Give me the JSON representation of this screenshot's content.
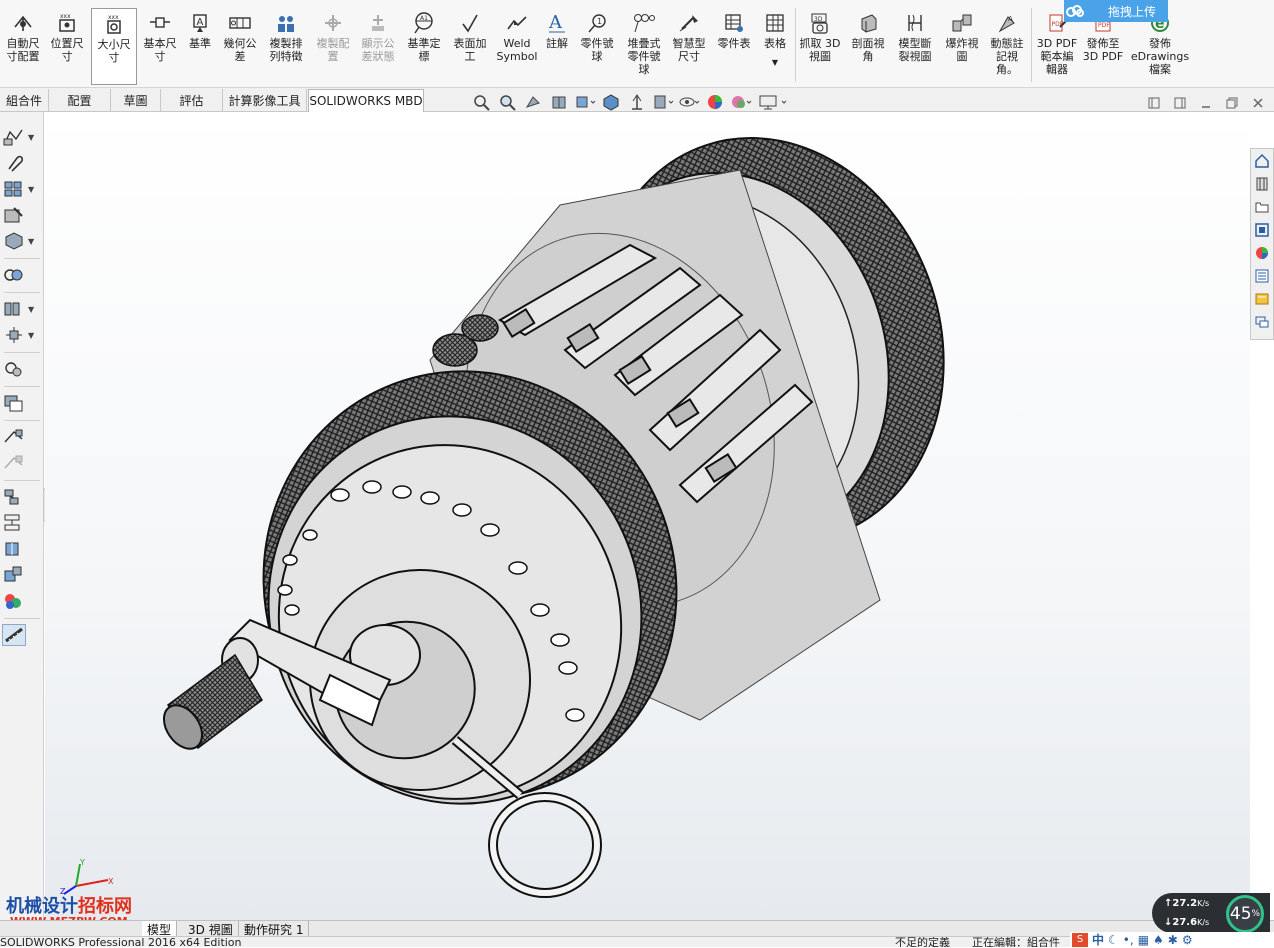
{
  "upload_widget": {
    "label": "拖拽上传"
  },
  "ribbon": {
    "buttons": [
      {
        "label": "自動尺\n寸配置",
        "icon": "auto-dimension-icon"
      },
      {
        "label": "位置尺\n寸",
        "icon": "location-dimension-icon"
      },
      {
        "label": "大小尺\n寸",
        "icon": "size-dimension-icon"
      },
      {
        "label": "基本尺\n寸",
        "icon": "basic-dimension-icon"
      },
      {
        "label": "基準",
        "icon": "datum-icon"
      },
      {
        "label": "幾何公\n差",
        "icon": "geometric-tolerance-icon"
      },
      {
        "label": "複製排\n列特徵",
        "icon": "copy-pattern-icon"
      },
      {
        "label": "複製配\n置",
        "icon": "copy-scheme-icon"
      },
      {
        "label": "顯示公\n差狀態",
        "icon": "tolerance-status-icon"
      },
      {
        "label": "基準定\n標",
        "icon": "datum-target-icon"
      },
      {
        "label": "表面加\n工",
        "icon": "surface-finish-icon"
      },
      {
        "label": "Weld\nSymbol",
        "icon": "weld-symbol-icon"
      },
      {
        "label": "註解",
        "icon": "note-icon"
      },
      {
        "label": "零件號\n球",
        "icon": "balloon-icon"
      },
      {
        "label": "堆疊式\n零件號\n球",
        "icon": "stacked-balloon-icon"
      },
      {
        "label": "智慧型\n尺寸",
        "icon": "smart-dimension-icon"
      },
      {
        "label": "零件表",
        "icon": "bom-icon"
      },
      {
        "label": "表格",
        "icon": "table-icon"
      },
      {
        "label": "抓取 3D\n視圖",
        "icon": "capture-3d-view-icon"
      },
      {
        "label": "剖面視\n角",
        "icon": "section-view-icon"
      },
      {
        "label": "模型斷\n裂視圖",
        "icon": "broken-view-icon"
      },
      {
        "label": "爆炸視\n圖",
        "icon": "exploded-view-icon"
      },
      {
        "label": "動態註\n記視\n角。",
        "icon": "dynamic-annotation-icon"
      },
      {
        "label": "3D PDF\n範本編\n輯器",
        "icon": "3d-pdf-template-icon"
      },
      {
        "label": "發佈至\n3D PDF",
        "icon": "publish-3d-pdf-icon"
      },
      {
        "label": "發佈\neDrawings\n檔案",
        "icon": "edrawings-icon"
      }
    ]
  },
  "tabs": [
    "組合件",
    "配置",
    "草圖",
    "評估",
    "計算影像工具",
    "SOLIDWORKS MBD"
  ],
  "bottom_tabs": [
    "模型",
    "3D 視圖",
    "動作研究 1"
  ],
  "status": {
    "app": "SOLIDWORKS Professional 2016 x64 Edition",
    "state1": "不足的定義",
    "state2": "正在編輯：組合件"
  },
  "netmon": {
    "up": "27.2",
    "down": "27.6",
    "unit": "K/s",
    "percent": "45",
    "percent_sign": "%"
  },
  "watermark": {
    "line1_a": "机械设计",
    "line1_b": "招标网",
    "line2": "WWW.MEZBW.COM"
  },
  "ime": {
    "lang": "中"
  },
  "colors": {
    "accent": "#4aa3e8",
    "ribbon_bg": "#f7f7f7",
    "netmon_ring": "#2fc38a"
  }
}
